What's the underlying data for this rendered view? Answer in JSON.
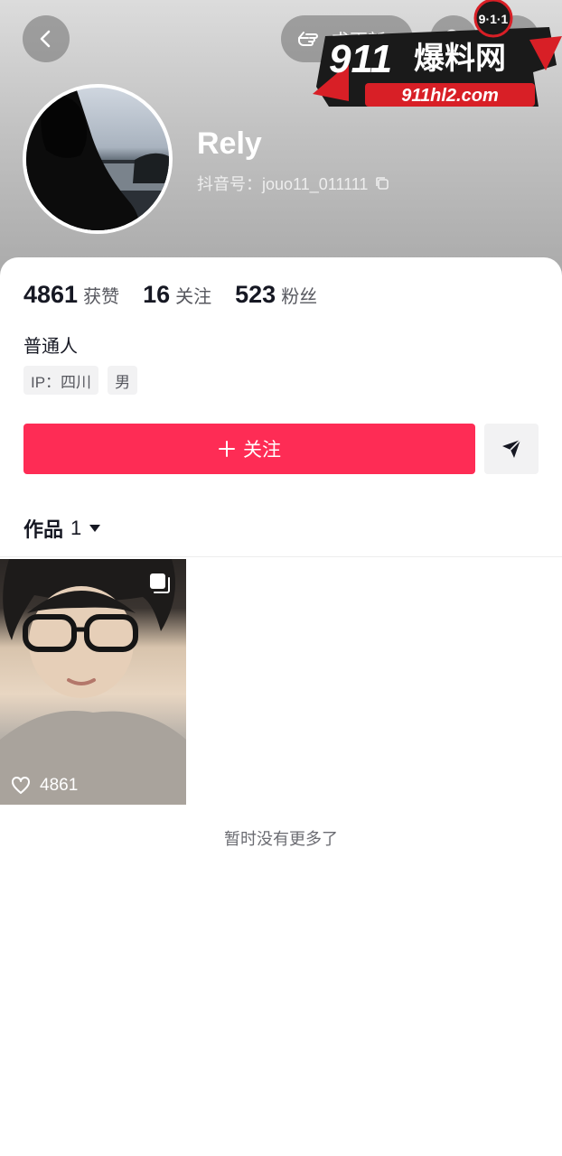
{
  "header": {
    "follow_pill_label": "求更新",
    "display_name": "Rely",
    "douyin_id": "抖音号：jouo11_011111"
  },
  "watermark": {
    "badge": "9·1·1",
    "title_num": "911",
    "title_cn": "爆料网",
    "domain": "911hl2.com"
  },
  "stats": {
    "likes_num": "4861",
    "likes_label": "获赞",
    "following_num": "16",
    "following_label": "关注",
    "fans_num": "523",
    "fans_label": "粉丝"
  },
  "bio": "普通人",
  "tags": {
    "ip": "IP：四川",
    "gender": "男"
  },
  "actions": {
    "follow_label": "关注"
  },
  "works": {
    "tab_label": "作品",
    "count": "1"
  },
  "video": {
    "likes": "4861"
  },
  "footer": {
    "no_more": "暂时没有更多了"
  },
  "colors": {
    "accent": "#fe2c55",
    "text": "#161823",
    "muted": "#57585f"
  },
  "icons": [
    "back-icon",
    "hand-point-icon",
    "search-icon",
    "more-icon",
    "copy-icon",
    "plus-icon",
    "send-icon",
    "caret-down-icon",
    "heart-icon",
    "multi-photo-icon"
  ]
}
